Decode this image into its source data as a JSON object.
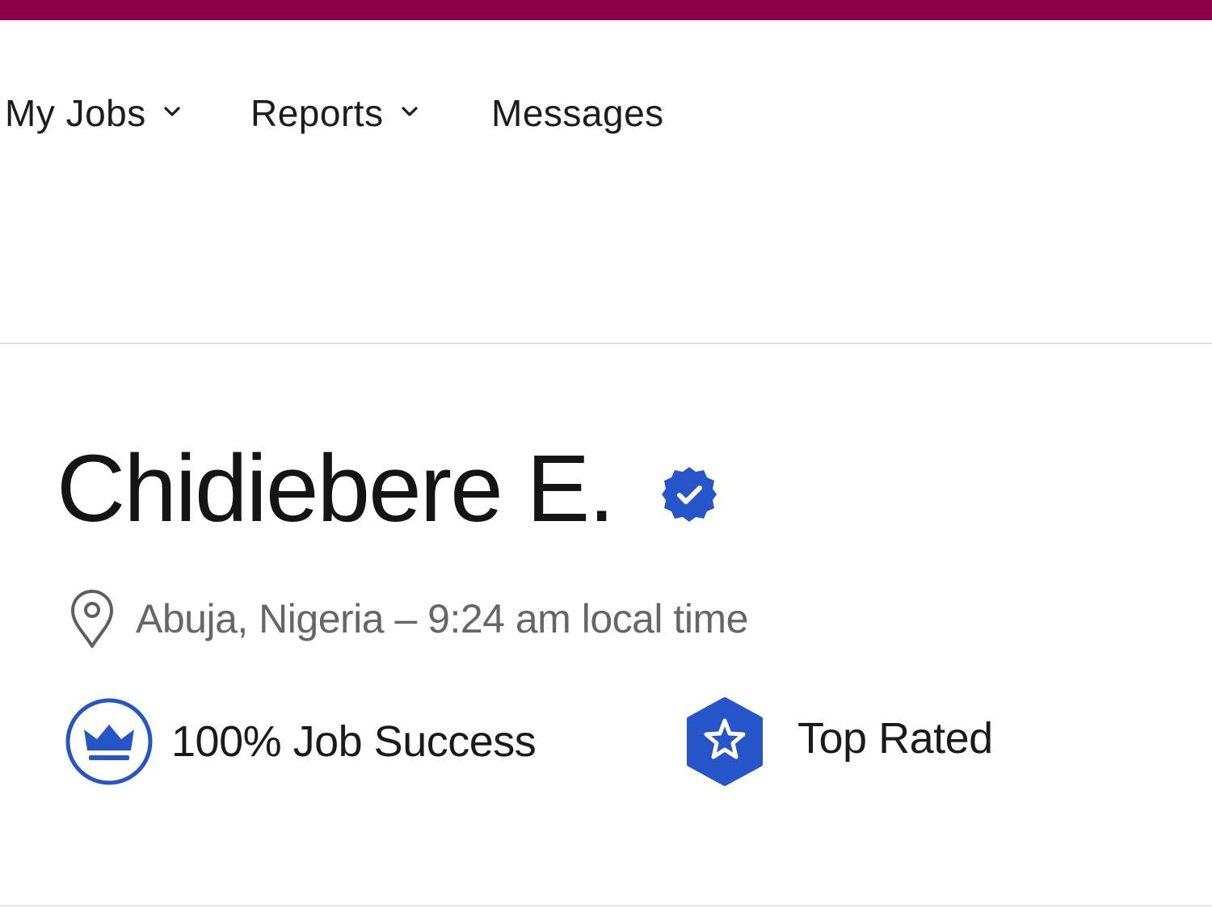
{
  "colors": {
    "brand_bar": "#8c0047",
    "badge_blue": "#2655c9",
    "text_muted": "#666666"
  },
  "nav": {
    "items": [
      {
        "label": "My Jobs",
        "has_dropdown": true
      },
      {
        "label": "Reports",
        "has_dropdown": true
      },
      {
        "label": "Messages",
        "has_dropdown": false
      }
    ]
  },
  "profile": {
    "name": "Chidiebere E.",
    "verified_icon": "verified-badge-icon",
    "location": "Abuja, Nigeria – 9:24 am local time",
    "location_icon": "location-pin-icon"
  },
  "badges": [
    {
      "label": "100% Job Success",
      "icon": "crown-icon",
      "value_percent": 100
    },
    {
      "label": "Top Rated",
      "icon": "star-hexagon-icon"
    }
  ]
}
